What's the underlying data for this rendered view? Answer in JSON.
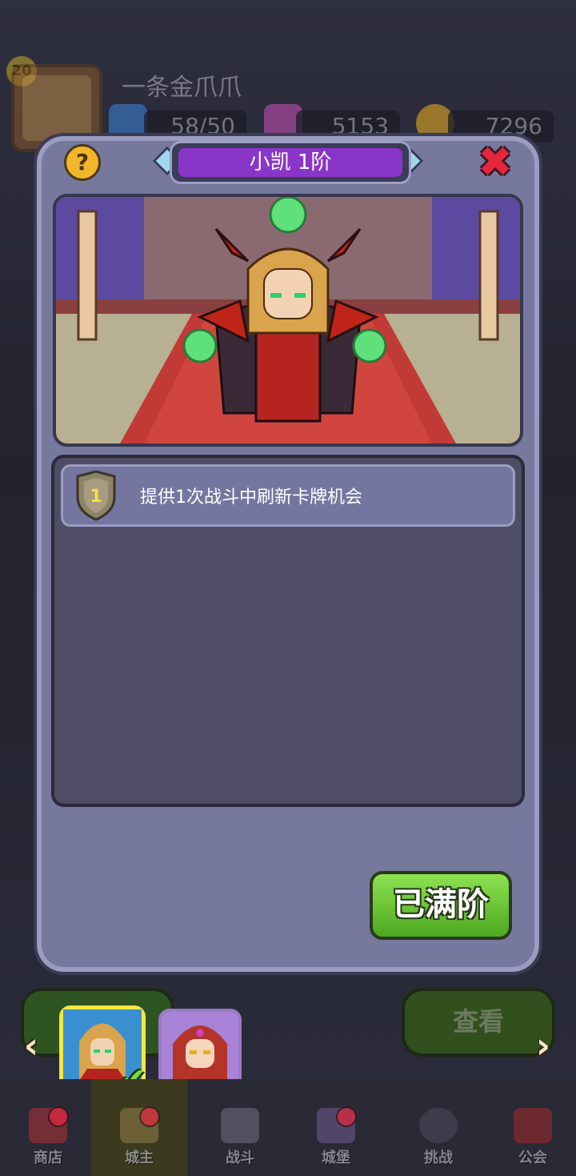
{
  "header": {
    "level": "20",
    "player_name": "一条金爪爪",
    "energy": "58/50",
    "gems": "5153",
    "gold": "7296"
  },
  "modal": {
    "title": "小凯 1阶",
    "help_label": "?",
    "close_label": "✖",
    "skills": [
      {
        "rank": "1",
        "text": "提供1次战斗中刷新卡牌机会"
      }
    ],
    "max_button_label": "已满阶"
  },
  "bottom": {
    "view_button_label": "查看",
    "prev_arrow": "‹",
    "next_arrow": "›",
    "check_mark": "✔"
  },
  "nav": {
    "items": [
      {
        "label": "商店",
        "icon": "shop-icon",
        "badge": true
      },
      {
        "label": "城主",
        "icon": "lord-icon",
        "badge": true,
        "active": true
      },
      {
        "label": "战斗",
        "icon": "swords-icon",
        "badge": false
      },
      {
        "label": "城堡",
        "icon": "castle-icon",
        "badge": true
      },
      {
        "label": "挑战",
        "icon": "challenge-icon",
        "badge": false
      },
      {
        "label": "公会",
        "icon": "guild-icon",
        "badge": false
      }
    ]
  },
  "colors": {
    "title_purple": "#8a35c9",
    "button_green": "#6cc93a",
    "close_red": "#e5263e",
    "modal_bg": "#77789e"
  }
}
